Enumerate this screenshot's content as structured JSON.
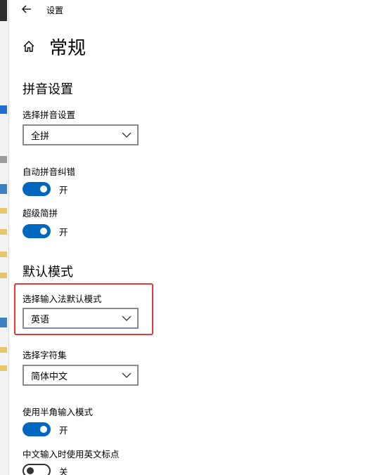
{
  "window": {
    "title": "设置"
  },
  "header": {
    "title": "常规"
  },
  "pinyin": {
    "section_title": "拼音设置",
    "select_label": "选择拼音设置",
    "select_value": "全拼",
    "auto_correct": {
      "label": "自动拼音纠错",
      "state": "开"
    },
    "super_jianpin": {
      "label": "超级简拼",
      "state": "开"
    }
  },
  "default_mode": {
    "section_title": "默认模式",
    "select_label": "选择输入法默认模式",
    "select_value": "英语",
    "charset_label": "选择字符集",
    "charset_value": "简体中文",
    "half_width": {
      "label": "使用半角输入模式",
      "state": "开"
    },
    "english_punct": {
      "label": "中文输入时使用英文标点",
      "state": "关"
    }
  },
  "icons": [
    "back-arrow-icon",
    "home-icon",
    "chevron-down-icon"
  ],
  "colors": {
    "accent": "#0067c0",
    "highlight": "#e03a3a"
  }
}
